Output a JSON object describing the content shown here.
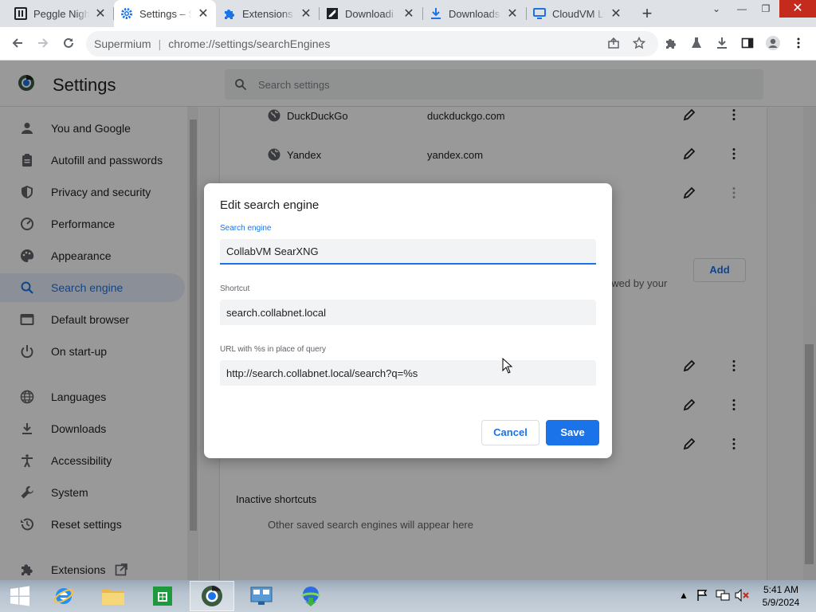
{
  "tabs": [
    {
      "title": "Peggle Nigh",
      "icon": "peggle-icon",
      "active": false
    },
    {
      "title": "Settings – S",
      "icon": "settings-gear-icon",
      "active": true
    },
    {
      "title": "Extensions",
      "icon": "puzzle-icon",
      "active": false
    },
    {
      "title": "Downloadi",
      "icon": "download-page-icon",
      "active": false
    },
    {
      "title": "Downloads",
      "icon": "download-icon",
      "active": false
    },
    {
      "title": "CloudVM Li",
      "icon": "monitor-icon",
      "active": false
    }
  ],
  "toolbar": {
    "browser_name": "Supermium",
    "url": "chrome://settings/searchEngines"
  },
  "settings": {
    "title": "Settings",
    "search_placeholder": "Search settings"
  },
  "sidebar": {
    "items": [
      {
        "label": "You and Google",
        "icon": "person-icon"
      },
      {
        "label": "Autofill and passwords",
        "icon": "clipboard-icon"
      },
      {
        "label": "Privacy and security",
        "icon": "shield-icon"
      },
      {
        "label": "Performance",
        "icon": "speedometer-icon"
      },
      {
        "label": "Appearance",
        "icon": "palette-icon"
      },
      {
        "label": "Search engine",
        "icon": "search-icon",
        "selected": true
      },
      {
        "label": "Default browser",
        "icon": "browser-window-icon"
      },
      {
        "label": "On start-up",
        "icon": "power-icon"
      },
      {
        "label": "Languages",
        "icon": "globe-icon"
      },
      {
        "label": "Downloads",
        "icon": "download-icon"
      },
      {
        "label": "Accessibility",
        "icon": "accessibility-icon"
      },
      {
        "label": "System",
        "icon": "wrench-icon"
      },
      {
        "label": "Reset settings",
        "icon": "history-icon"
      },
      {
        "label": "Extensions",
        "icon": "puzzle-icon"
      }
    ]
  },
  "main": {
    "engines": [
      {
        "name": "DuckDuckGo",
        "domain": "duckduckgo.com"
      },
      {
        "name": "Yandex",
        "domain": "yandex.com"
      }
    ],
    "add_label": "Add",
    "site_search_desc_fragment": "owed by your",
    "inactive_title": "Inactive shortcuts",
    "inactive_desc": "Other saved search engines will appear here"
  },
  "dialog": {
    "title": "Edit search engine",
    "engine_label": "Search engine",
    "engine_value": "CollabVM SearXNG",
    "shortcut_label": "Shortcut",
    "shortcut_value": "search.collabnet.local",
    "url_label": "URL with %s in place of query",
    "url_value": "http://search.collabnet.local/search?q=%s",
    "cancel_label": "Cancel",
    "save_label": "Save"
  },
  "taskbar": {
    "time": "5:41 AM",
    "date": "5/9/2024",
    "apps": [
      "internet-explorer-icon",
      "file-explorer-icon",
      "store-icon",
      "supermium-icon",
      "network-icon",
      "download-manager-icon"
    ]
  },
  "colors": {
    "accent": "#1a73e8",
    "selected_bg": "#e8f0fe",
    "close_red": "#c42b1c"
  }
}
